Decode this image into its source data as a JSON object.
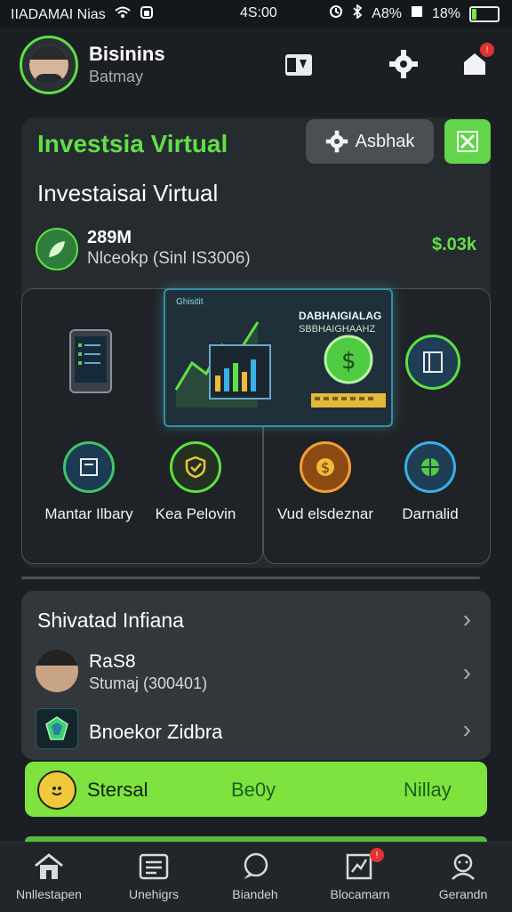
{
  "status_bar": {
    "carrier": "IIADAMAI Nias",
    "time": "4S:00",
    "battery_text": "18%",
    "battery_level": 0.18,
    "signal_text": "A8%"
  },
  "header": {
    "user_name": "Bisinins",
    "user_sub": "Batmay"
  },
  "main_card": {
    "title_green": "Investsia Virtual",
    "settings_chip": "Asbhak",
    "subtitle": "Investaisai Virtual",
    "asset_value": "289M",
    "asset_note": "Nlceokp (Sinl IS3006)",
    "asset_change": "$.03k",
    "hero_label_top": "Ghisitit",
    "hero_label_a": "DABHAIGIALAG",
    "hero_label_b": "SBBHAIGHAAHZ",
    "features": [
      {
        "label": "Mantar Ilbary",
        "icon": "document-icon"
      },
      {
        "label": "Kea Pelovin",
        "icon": "shield-check-icon"
      },
      {
        "label": "Vud elsdeznar",
        "icon": "coin-icon"
      },
      {
        "label": "Darnalid",
        "icon": "globe-icon"
      }
    ]
  },
  "list_card": {
    "title": "Shivatad Infiana",
    "person_name": "RaS8",
    "person_sub": "Stumaj (300401)",
    "gem_name": "Bnoekor Zidbra"
  },
  "cta": {
    "left": "Stersal",
    "middle": "Be0y",
    "right": "Nillay"
  },
  "bottom_nav": [
    {
      "label": "Nnllestapen",
      "icon": "home-icon"
    },
    {
      "label": "Unehigrs",
      "icon": "list-icon"
    },
    {
      "label": "Biandeh",
      "icon": "chat-icon"
    },
    {
      "label": "Blocamarn",
      "icon": "chart-icon"
    },
    {
      "label": "Gerandn",
      "icon": "profile-icon"
    }
  ],
  "colors": {
    "accent": "#61e046",
    "cta": "#7ee33f",
    "background": "#1b1f23",
    "card": "#262b30"
  }
}
